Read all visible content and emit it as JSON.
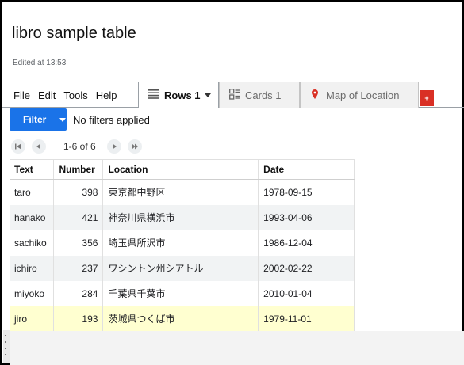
{
  "document": {
    "title": "libro sample table",
    "edited": "Edited at 13:53"
  },
  "menu": [
    "File",
    "Edit",
    "Tools",
    "Help"
  ],
  "tabs": {
    "rows": {
      "label": "Rows 1",
      "icon": "list-icon"
    },
    "cards": {
      "label": "Cards 1",
      "icon": "cards-icon"
    },
    "map": {
      "label": "Map of Location",
      "icon": "map-pin-icon"
    },
    "add": "+"
  },
  "filter": {
    "button_label": "Filter",
    "status": "No filters applied"
  },
  "pager": {
    "range": "1-6 of 6"
  },
  "table": {
    "headers": [
      "Text",
      "Number",
      "Location",
      "Date"
    ],
    "rows": [
      {
        "text": "taro",
        "number": "398",
        "location": "東京都中野区",
        "date": "1978-09-15"
      },
      {
        "text": "hanako",
        "number": "421",
        "location": "神奈川県横浜市",
        "date": "1993-04-06"
      },
      {
        "text": "sachiko",
        "number": "356",
        "location": "埼玉県所沢市",
        "date": "1986-12-04"
      },
      {
        "text": "ichiro",
        "number": "237",
        "location": "ワシントン州シアトル",
        "date": "2002-02-22"
      },
      {
        "text": "miyoko",
        "number": "284",
        "location": "千葉県千葉市",
        "date": "2010-01-04"
      },
      {
        "text": "jiro",
        "number": "193",
        "location": "茨城県つくば市",
        "date": "1979-11-01"
      }
    ],
    "selected_row": 5
  },
  "colors": {
    "accent": "#1a73e8",
    "add_tab": "#d93025",
    "selected_row": "#ffffd0",
    "alt_row": "#f1f3f4"
  }
}
